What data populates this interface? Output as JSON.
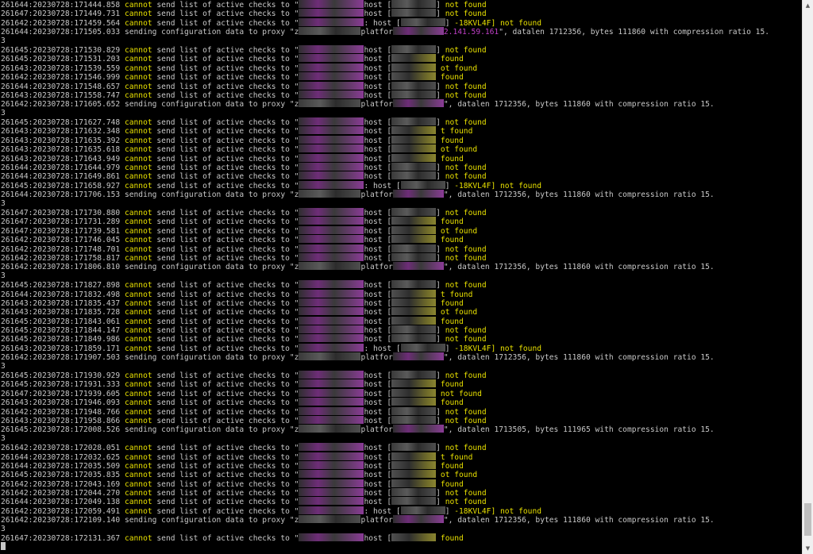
{
  "terminal": {
    "lines": [
      {
        "k": "check",
        "prefix": "261644:20230728:171444.858",
        "host": "host",
        "tail": "not found",
        "r": "a"
      },
      {
        "k": "check",
        "prefix": "261647:20230728:171449.731",
        "host": "host",
        "tail": "not found",
        "r": "a"
      },
      {
        "k": "check",
        "prefix": "261642:20230728:171459.564",
        "host": ": host",
        "tail": "-18KVL4F] not found",
        "r": "b"
      },
      {
        "k": "config",
        "prefix": "261644:20230728:171505.033",
        "ip": "2.141.59.161",
        "datalen": "1712356",
        "bytes": "111860"
      },
      {
        "k": "wrap",
        "text": "3"
      },
      {
        "k": "check",
        "prefix": "261645:20230728:171530.829",
        "host": "host",
        "tail": "not found",
        "r": "a"
      },
      {
        "k": "check",
        "prefix": "261645:20230728:171531.203",
        "host": "host",
        "tail": "found",
        "r": "c"
      },
      {
        "k": "check",
        "prefix": "261643:20230728:171539.559",
        "host": "host",
        "tail": "ot found",
        "r": "c"
      },
      {
        "k": "check",
        "prefix": "261642:20230728:171546.999",
        "host": "host",
        "tail": "found",
        "r": "c"
      },
      {
        "k": "check",
        "prefix": "261644:20230728:171548.657",
        "host": "host",
        "tail": "not found",
        "r": "a"
      },
      {
        "k": "check",
        "prefix": "261643:20230728:171558.747",
        "host": "host",
        "tail": "not found",
        "r": "a"
      },
      {
        "k": "config",
        "prefix": "261642:20230728:171605.652",
        "ip": "",
        "datalen": "1712356",
        "bytes": "111860"
      },
      {
        "k": "wrap",
        "text": "3"
      },
      {
        "k": "check",
        "prefix": "261645:20230728:171627.748",
        "host": "host",
        "tail": "not found",
        "r": "a"
      },
      {
        "k": "check",
        "prefix": "261643:20230728:171632.348",
        "host": "host",
        "tail": "t found",
        "r": "c"
      },
      {
        "k": "check",
        "prefix": "261643:20230728:171635.392",
        "host": "host",
        "tail": "found",
        "r": "c"
      },
      {
        "k": "check",
        "prefix": "261643:20230728:171635.618",
        "host": "host",
        "tail": "ot found",
        "r": "c"
      },
      {
        "k": "check",
        "prefix": "261643:20230728:171643.949",
        "host": "host",
        "tail": "found",
        "r": "c"
      },
      {
        "k": "check",
        "prefix": "261644:20230728:171644.979",
        "host": "host",
        "tail": "not found",
        "r": "a"
      },
      {
        "k": "check",
        "prefix": "261644:20230728:171649.861",
        "host": "host",
        "tail": "not found",
        "r": "a"
      },
      {
        "k": "check",
        "prefix": "261645:20230728:171658.927",
        "host": ": host",
        "tail": "-18KVL4F] not found",
        "r": "b"
      },
      {
        "k": "config",
        "prefix": "261644:20230728:171706.153",
        "ip": "",
        "datalen": "1712356",
        "bytes": "111860"
      },
      {
        "k": "wrap",
        "text": "3"
      },
      {
        "k": "check",
        "prefix": "261647:20230728:171730.880",
        "host": "host",
        "tail": "not found",
        "r": "a"
      },
      {
        "k": "check",
        "prefix": "261647:20230728:171731.289",
        "host": "host",
        "tail": "found",
        "r": "c"
      },
      {
        "k": "check",
        "prefix": "261647:20230728:171739.581",
        "host": "host",
        "tail": "ot found",
        "r": "c"
      },
      {
        "k": "check",
        "prefix": "261642:20230728:171746.045",
        "host": "host",
        "tail": "found",
        "r": "c"
      },
      {
        "k": "check",
        "prefix": "261642:20230728:171748.701",
        "host": "host",
        "tail": "not found",
        "r": "a"
      },
      {
        "k": "check",
        "prefix": "261642:20230728:171758.817",
        "host": "host",
        "tail": "not found",
        "r": "a"
      },
      {
        "k": "config",
        "prefix": "261642:20230728:171806.810",
        "ip": "",
        "datalen": "1712356",
        "bytes": "111860"
      },
      {
        "k": "wrap",
        "text": "3"
      },
      {
        "k": "check",
        "prefix": "261645:20230728:171827.898",
        "host": "host",
        "tail": "not found",
        "r": "a"
      },
      {
        "k": "check",
        "prefix": "261644:20230728:171832.498",
        "host": "host",
        "tail": "t found",
        "r": "c"
      },
      {
        "k": "check",
        "prefix": "261643:20230728:171835.437",
        "host": "host",
        "tail": "found",
        "r": "c"
      },
      {
        "k": "check",
        "prefix": "261643:20230728:171835.728",
        "host": "host",
        "tail": "ot found",
        "r": "c"
      },
      {
        "k": "check",
        "prefix": "261645:20230728:171843.061",
        "host": "host",
        "tail": "found",
        "r": "c"
      },
      {
        "k": "check",
        "prefix": "261645:20230728:171844.147",
        "host": "host",
        "tail": "not found",
        "r": "a"
      },
      {
        "k": "check",
        "prefix": "261645:20230728:171849.986",
        "host": "host",
        "tail": "not found",
        "r": "a"
      },
      {
        "k": "check",
        "prefix": "261643:20230728:171859.171",
        "host": ": host",
        "tail": "-18KVL4F] not found",
        "r": "b"
      },
      {
        "k": "config",
        "prefix": "261642:20230728:171907.503",
        "ip": "",
        "datalen": "1712356",
        "bytes": "111860"
      },
      {
        "k": "wrap",
        "text": "3"
      },
      {
        "k": "check",
        "prefix": "261645:20230728:171930.929",
        "host": "host",
        "tail": "not found",
        "r": "a"
      },
      {
        "k": "check",
        "prefix": "261645:20230728:171931.333",
        "host": "host",
        "tail": "found",
        "r": "c"
      },
      {
        "k": "check",
        "prefix": "261647:20230728:171939.605",
        "host": "host",
        "tail": "not found",
        "r": "c"
      },
      {
        "k": "check",
        "prefix": "261643:20230728:171946.093",
        "host": "host",
        "tail": "found",
        "r": "c"
      },
      {
        "k": "check",
        "prefix": "261642:20230728:171948.766",
        "host": "host",
        "tail": "not found",
        "r": "a"
      },
      {
        "k": "check",
        "prefix": "261643:20230728:171958.866",
        "host": "host",
        "tail": "not found",
        "r": "a"
      },
      {
        "k": "config",
        "prefix": "261645:20230728:172008.526",
        "ip": "",
        "datalen": "1713505",
        "bytes": "111965"
      },
      {
        "k": "wrap",
        "text": "3"
      },
      {
        "k": "check",
        "prefix": "261642:20230728:172028.051",
        "host": "host",
        "tail": "not found",
        "r": "a"
      },
      {
        "k": "check",
        "prefix": "261644:20230728:172032.625",
        "host": "host",
        "tail": "t found",
        "r": "c"
      },
      {
        "k": "check",
        "prefix": "261644:20230728:172035.509",
        "host": "host",
        "tail": "found",
        "r": "c"
      },
      {
        "k": "check",
        "prefix": "261645:20230728:172035.835",
        "host": "host",
        "tail": "ot found",
        "r": "c"
      },
      {
        "k": "check",
        "prefix": "261642:20230728:172043.169",
        "host": "host",
        "tail": "found",
        "r": "c"
      },
      {
        "k": "check",
        "prefix": "261642:20230728:172044.270",
        "host": "host",
        "tail": "not found",
        "r": "a"
      },
      {
        "k": "check",
        "prefix": "261644:20230728:172049.138",
        "host": "host",
        "tail": "not found",
        "r": "a"
      },
      {
        "k": "check",
        "prefix": "261642:20230728:172059.491",
        "host": ": host",
        "tail": "-18KVL4F] not found",
        "r": "b"
      },
      {
        "k": "config",
        "prefix": "261642:20230728:172109.140",
        "ip": "",
        "datalen": "1712356",
        "bytes": "111860"
      },
      {
        "k": "wrap",
        "text": "3"
      },
      {
        "k": "check",
        "prefix": "261647:20230728:172131.367",
        "host": "host",
        "tail": "found",
        "r": "c"
      },
      {
        "k": "prompt",
        "text": ""
      }
    ],
    "phrases": {
      "cannot": "cannot",
      "send_list": " send list of active checks to \"",
      "sending_config": " sending configuration data to proxy \"z",
      "platform": "platfor",
      "datalen_label": "\", datalen ",
      "bytes_label": ", bytes ",
      "ratio_label": " with compression ratio 15."
    }
  },
  "scrollbar": {
    "up_arrow_icon": "▲",
    "down_arrow_icon": "▼",
    "thumb_position": 0.985,
    "thumb_fraction": 0.06
  },
  "colors": {
    "background": "#000000",
    "text": "#c8c8c8",
    "keyword": "#e8e000",
    "highlight": "#c040c8"
  }
}
